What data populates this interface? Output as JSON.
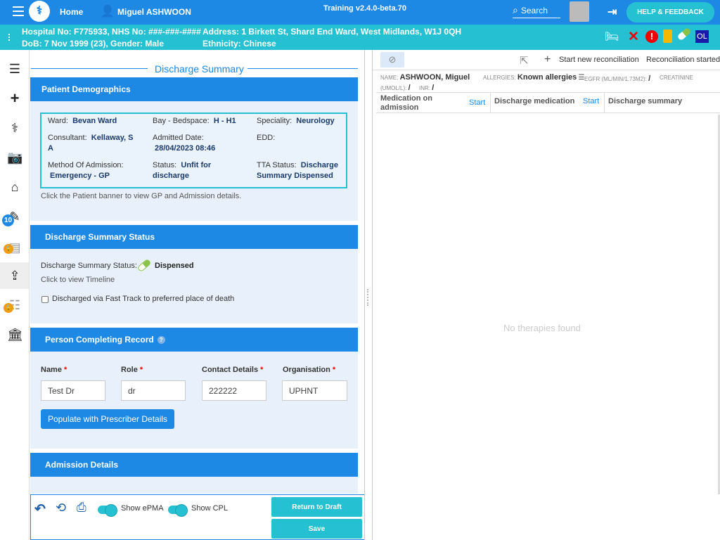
{
  "topbar": {
    "home": "Home",
    "patient_name": "Miguel ASHWOON",
    "version": "Training v2.4.0-beta.70",
    "search": "Search",
    "help": "HELP & FEEDBACK"
  },
  "banner": {
    "hospital": "Hospital No: F775933, NHS No: ###-###-####",
    "address": "Address: 1 Birkett St, Shard End Ward, West Midlands, W1J 0QH",
    "dob": "DoB: 7 Nov 1999 (23), Gender: Male",
    "ethnicity": "Ethnicity: Chinese",
    "ol": "OL"
  },
  "nav": {
    "badge": "10"
  },
  "discharge": {
    "title": "Discharge Summary",
    "demographics": {
      "heading": "Patient Demographics",
      "ward_label": "Ward:",
      "ward_value": "Bevan Ward",
      "bay_label": "Bay - Bedspace:",
      "bay_value": "H - H1",
      "speciality_label": "Speciality:",
      "speciality_value": "Neurology",
      "consultant_label": "Consultant:",
      "consultant_value_1": "Kellaway, S",
      "consultant_value_2": "A",
      "admitted_label": "Admitted Date:",
      "admitted_value": "28/04/2023 08:46",
      "edd_label": "EDD:",
      "method_label": "Method Of Admission:",
      "method_value": "Emergency - GP",
      "status_label": "Status:",
      "status_value_1": "Unfit for",
      "status_value_2": "discharge",
      "tta_label": "TTA Status:",
      "tta_value_1": "Discharge",
      "tta_value_2": "Summary Dispensed",
      "note": "Click the Patient banner to view GP and Admission details."
    },
    "status": {
      "heading": "Discharge Summary Status",
      "label": "Discharge Summary Status:",
      "value": "Dispensed",
      "timeline": "Click to view Timeline",
      "fast_track": "Discharged via Fast Track to preferred place of death"
    },
    "person": {
      "heading": "Person Completing Record",
      "name_label": "Name",
      "role_label": "Role",
      "contact_label": "Contact Details",
      "org_label": "Organisation",
      "required": "*",
      "name_value": "Test Dr",
      "role_value": "dr",
      "contact_value": "222222",
      "org_value": "UPHNT",
      "populate": "Populate with Prescriber Details"
    },
    "admission": {
      "heading": "Admission Details"
    },
    "footer": {
      "show_epma": "Show ePMA",
      "show_cpl": "Show CPL",
      "return_draft": "Return to Draft",
      "save": "Save"
    }
  },
  "reconciliation": {
    "start_new": "Start new reconciliation",
    "started": "Reconciliation started",
    "name_label": "NAME:",
    "name_value": "ASHWOON, Miguel",
    "allergies_label": "ALLERGIES:",
    "allergies_value": "Known allergies",
    "egfr_label": "EGFR (ML/MIN/1.73M2):",
    "egfr_value": "/",
    "creatinine_label": "CREATININE",
    "umol_label": "(UMOL/L):",
    "umol_value": "/",
    "inr_label": "INR:",
    "inr_value": "/",
    "col_admission_1": "Medication on",
    "col_admission_2": "admission",
    "col_start": "Start",
    "col_discharge": "Discharge medication",
    "col_summary": "Discharge summary",
    "empty": "No therapies found"
  },
  "colors": {
    "primary": "#1e88e5",
    "accent": "#26c0d3",
    "panel": "#e8f1fb"
  }
}
